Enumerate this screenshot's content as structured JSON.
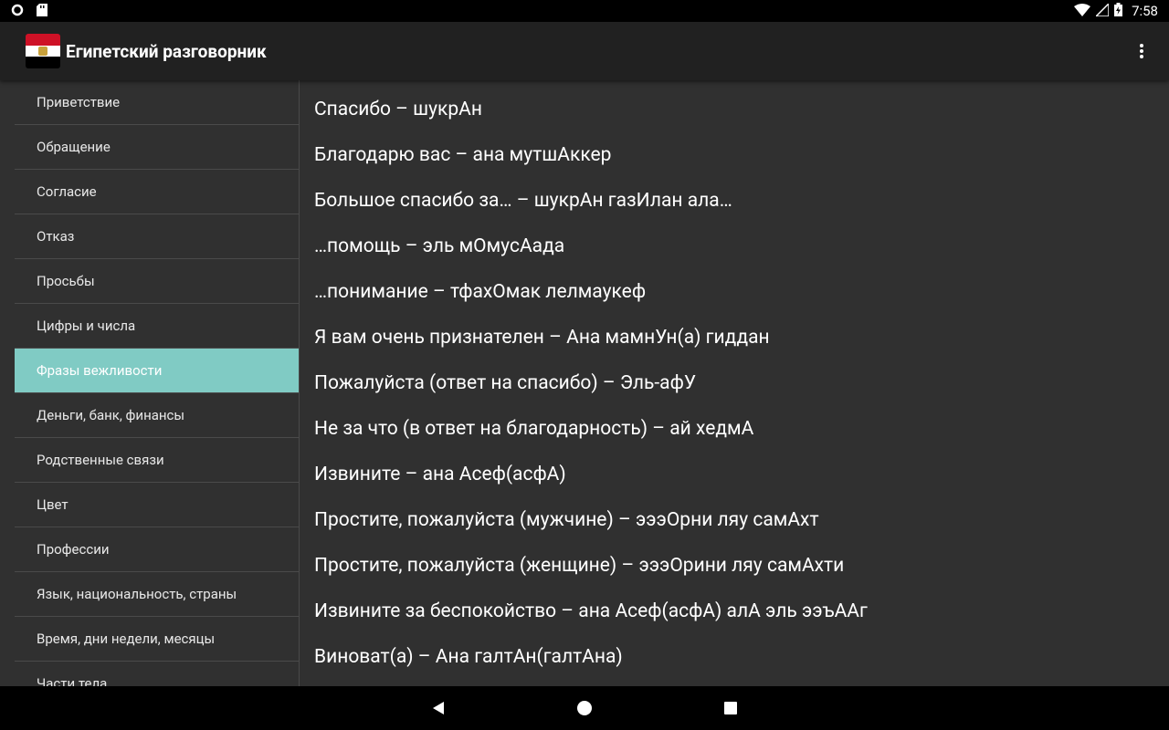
{
  "status_bar": {
    "time": "7:58"
  },
  "app_bar": {
    "title": "Египетский разговорник",
    "flag_colors": [
      "#ce1126",
      "#ffffff",
      "#000000"
    ]
  },
  "sidebar": {
    "items": [
      {
        "label": "Приветствие"
      },
      {
        "label": "Обращение"
      },
      {
        "label": "Согласие"
      },
      {
        "label": "Отказ"
      },
      {
        "label": "Просьбы"
      },
      {
        "label": "Цифры и числа"
      },
      {
        "label": "Фразы вежливости"
      },
      {
        "label": "Деньги, банк, финансы"
      },
      {
        "label": "Родственные связи"
      },
      {
        "label": "Цвет"
      },
      {
        "label": "Профессии"
      },
      {
        "label": "Язык, национальность, страны"
      },
      {
        "label": "Время, дни недели, месяцы"
      },
      {
        "label": "Части тела"
      }
    ],
    "selected": "Фразы вежливости"
  },
  "phrases": [
    "Спасибо – шукрАн",
    "Благодарю вас – ана мутшАккер",
    "Большое спасибо за… – шукрАн газИлан ала…",
    "…помощь – эль мОмусАада",
    "…понимание – тфахОмак лелмаукеф",
    "Я вам очень признателен – Ана мамнУн(а) гиддан",
    "Пожалуйста (ответ на спасибо) – Эль-афУ",
    "Не за что (в ответ на благодарность) – ай хедмА",
    "Извините – ана Асеф(асфА)",
    "Простите, пожалуйста (мужчине) – эээОрни ляу самАхт",
    "Простите, пожалуйста (женщине) – эээОрини ляу самАхти",
    "Извините за беспокойство – ана Асеф(асфА) алА эль ээъААг",
    "Виноват(а) – Ана галтАн(галтАна)"
  ],
  "colors": {
    "accent": "#80cbc4",
    "app_bar": "#212121",
    "background": "#303030"
  }
}
